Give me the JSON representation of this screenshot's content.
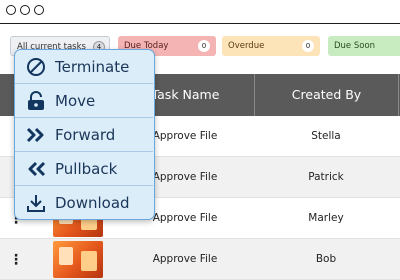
{
  "filters": [
    {
      "label": "All current tasks",
      "count": "4"
    },
    {
      "label": "Due Today",
      "count": "0"
    },
    {
      "label": "Overdue",
      "count": "0"
    },
    {
      "label": "Due Soon",
      "count": ""
    }
  ],
  "table": {
    "headers": {
      "task_name": "Task Name",
      "created_by": "Created By"
    },
    "rows": [
      {
        "menu_glyph": "",
        "task": "Approve File",
        "created_by": "Stella"
      },
      {
        "menu_glyph": "",
        "task": "Approve File",
        "created_by": "Patrick"
      },
      {
        "menu_glyph": "⋮",
        "task": "Approve File",
        "created_by": "Marley"
      },
      {
        "menu_glyph": "⋮",
        "task": "Approve File",
        "created_by": "Bob"
      }
    ]
  },
  "context_menu": {
    "items": [
      {
        "label": "Terminate",
        "icon": "prohibited-icon"
      },
      {
        "label": "Move",
        "icon": "unlocked-padlock-icon"
      },
      {
        "label": "Forward",
        "icon": "double-chevron-right-icon"
      },
      {
        "label": "Pullback",
        "icon": "double-chevron-left-icon"
      },
      {
        "label": "Download",
        "icon": "download-icon"
      }
    ]
  },
  "colors": {
    "header_bg": "#5a5a5a",
    "menu_bg": "#dcedfa",
    "menu_border": "#6aa7dd",
    "due_today": "#f5b4b4",
    "overdue": "#fde3b8",
    "due_soon": "#c8ecc0"
  }
}
